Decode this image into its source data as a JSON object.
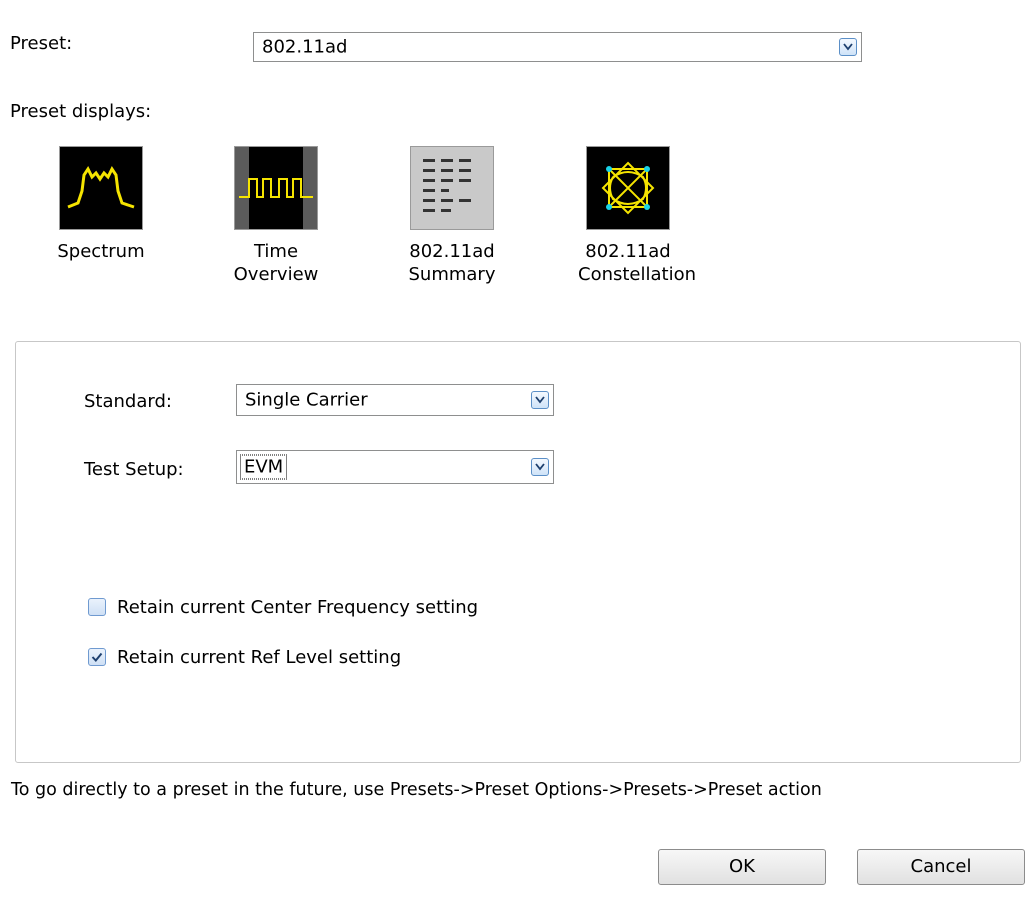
{
  "preset": {
    "label": "Preset:",
    "value": "802.11ad"
  },
  "preset_displays": {
    "label": "Preset displays:",
    "items": [
      {
        "line1": "Spectrum",
        "line2": "",
        "icon": "spectrum-icon"
      },
      {
        "line1": "Time Overview",
        "line2": "",
        "icon": "time-overview-icon"
      },
      {
        "line1": "802.11ad",
        "line2": "Summary",
        "icon": "summary-icon"
      },
      {
        "line1": "802.11ad",
        "line2": "Constellation",
        "icon": "constellation-icon"
      }
    ]
  },
  "settings": {
    "standard_label": "Standard:",
    "standard_value": "Single Carrier",
    "test_setup_label": "Test Setup:",
    "test_setup_value": "EVM",
    "retain_center_label": "Retain current Center Frequency setting",
    "retain_center_checked": false,
    "retain_ref_label": "Retain current Ref Level setting",
    "retain_ref_checked": true
  },
  "hint": "To go directly to a preset in the future, use Presets->Preset Options->Presets->Preset action",
  "buttons": {
    "ok": "OK",
    "cancel": "Cancel"
  },
  "colors": {
    "trace": "#f5e400",
    "constellation_point": "#19d3e8",
    "accent": "#5b8fc7"
  }
}
